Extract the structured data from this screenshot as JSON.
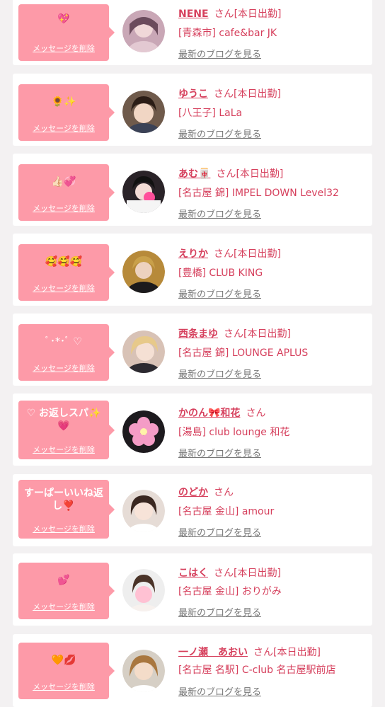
{
  "colors": {
    "accent": "#d6405d",
    "bubble": "#fd9aa8",
    "link_gray": "#777777"
  },
  "delete_label": "メッセージを削除",
  "blog_label": "最新のブログを見る",
  "san_label": "さん",
  "items": [
    {
      "message": "💖",
      "name": "NENE",
      "tag": "[本日出勤]",
      "shop": "[青森市] cafe&bar JK"
    },
    {
      "message": "🌻✨",
      "name": "ゆうこ",
      "tag": "[本日出勤]",
      "shop": "[八王子] LaLa"
    },
    {
      "message": "👍🏻💞",
      "name": "あむ🀄",
      "tag": "[本日出勤]",
      "shop": "[名古屋 錦] IMPEL DOWN Level32"
    },
    {
      "message": "🥰🥰🥰",
      "name": "えりか",
      "tag": "[本日出勤]",
      "shop": "[豊橋] CLUB KING"
    },
    {
      "message": "ﾟ･*･ﾟ ♡",
      "name": "西条まゆ",
      "tag": "[本日出勤]",
      "shop": "[名古屋 錦] LOUNGE APLUS"
    },
    {
      "message": "♡ お返しスパ✨💗",
      "name": "かのん🎀和花",
      "tag": "",
      "shop": "[湯島] club lounge 和花"
    },
    {
      "message": "すーぱーいいね返し❣️",
      "name": "のどか",
      "tag": "",
      "shop": "[名古屋 金山] amour"
    },
    {
      "message": "💕",
      "name": "こはく",
      "tag": "[本日出勤]",
      "shop": "[名古屋 金山] おりがみ"
    },
    {
      "message": "🧡💋",
      "name": "一ノ瀬　あおい",
      "tag": "[本日出勤]",
      "shop": "[名古屋 名駅] C-club 名古屋駅前店"
    }
  ]
}
